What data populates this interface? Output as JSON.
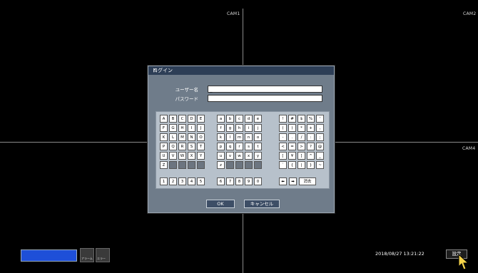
{
  "cameras": {
    "cam1": "CAM1",
    "cam2": "CAM2",
    "cam4": "CAM4"
  },
  "dialog": {
    "title": "ログイン",
    "close": "×",
    "username_label": "ユーザー名",
    "username_value": "_",
    "password_label": "パスワード",
    "password_value": "",
    "ok_label": "OK",
    "cancel_label": "キャンセル"
  },
  "keyboard": {
    "upper": [
      "A",
      "B",
      "C",
      "D",
      "E",
      "F",
      "G",
      "H",
      "I",
      "J",
      "K",
      "L",
      "M",
      "N",
      "O",
      "P",
      "Q",
      "R",
      "S",
      "T",
      "U",
      "V",
      "W",
      "X",
      "Y",
      "Z",
      "",
      "",
      "",
      ""
    ],
    "lower": [
      "a",
      "b",
      "c",
      "d",
      "e",
      "f",
      "g",
      "h",
      "i",
      "j",
      "k",
      "l",
      "m",
      "n",
      "o",
      "p",
      "q",
      "r",
      "s",
      "t",
      "u",
      "v",
      "w",
      "x",
      "y",
      "z",
      "",
      "",
      "",
      ""
    ],
    "symbols": [
      "!",
      "#",
      "$",
      "%",
      "'",
      "(",
      ")",
      "*",
      "+",
      ",",
      "-",
      ".",
      "/",
      ":",
      ";",
      "<",
      "=",
      ">",
      "?",
      "@",
      "[",
      "¥",
      "]",
      "^",
      "_",
      "`",
      "{",
      "|",
      "}",
      "~"
    ],
    "digits_left": [
      "1",
      "2",
      "3",
      "4",
      "5"
    ],
    "digits_right": [
      "6",
      "7",
      "8",
      "9",
      "0"
    ],
    "left_arrow": "⬅",
    "right_arrow": "➡",
    "delete_label": "消去"
  },
  "statusbar": {
    "alarm_label": "アラーム",
    "error_label": "エラー",
    "datetime": "2018/08/27 13:21:22",
    "settings_label": "設定"
  },
  "colors": {
    "title_bar": "#2d3e56",
    "dialog_bg": "#6f7c8a",
    "blue_box": "#1e4fd8"
  }
}
